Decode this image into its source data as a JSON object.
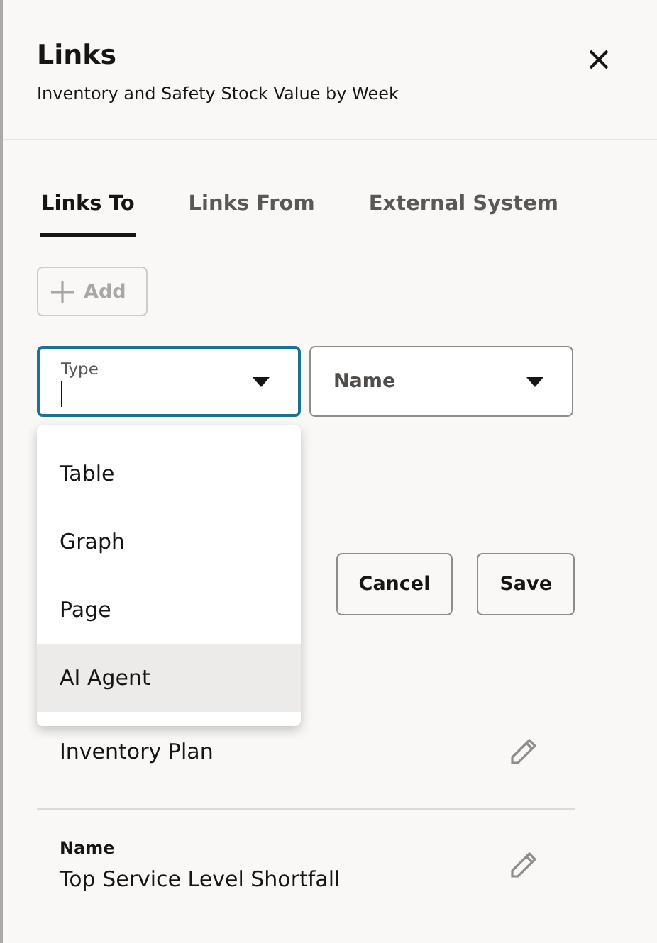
{
  "header": {
    "title": "Links",
    "subtitle": "Inventory and Safety Stock Value by Week"
  },
  "tabs": [
    {
      "label": "Links To",
      "selected": true
    },
    {
      "label": "Links From",
      "selected": false
    },
    {
      "label": "External System",
      "selected": false
    }
  ],
  "add_button": {
    "label": "Add",
    "disabled": true
  },
  "form": {
    "type_field": {
      "label": "Type",
      "focused": true
    },
    "name_field": {
      "placeholder": "Name"
    },
    "type_options": [
      {
        "label": "Table",
        "selected": false
      },
      {
        "label": "Graph",
        "selected": false
      },
      {
        "label": "Page",
        "selected": false
      },
      {
        "label": "AI Agent",
        "selected": true
      }
    ],
    "buttons": [
      "Cancel",
      "Save"
    ]
  },
  "links": [
    {
      "value": "Inventory Plan"
    },
    {
      "label": "Name",
      "value": "Top Service Level Shortfall"
    }
  ]
}
